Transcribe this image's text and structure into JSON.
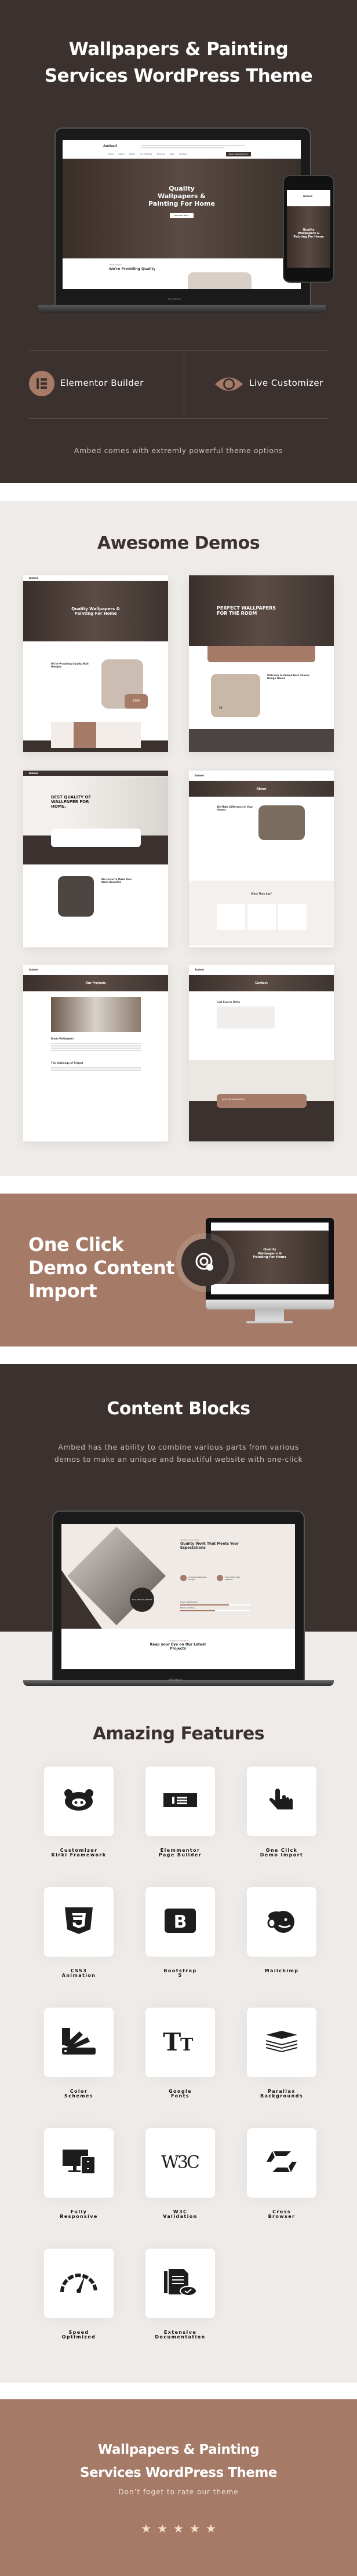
{
  "hero": {
    "title_line1": "Wallpapers & Painting",
    "title_line2": "Services WordPress Theme",
    "mockup": {
      "logo": "Ambed",
      "nav": [
        "Home",
        "About",
        "Pages",
        "Our Projects",
        "Services",
        "Blog",
        "Contact"
      ],
      "cta": "Book Appointment",
      "headline": [
        "Quality",
        "Wallpapers &",
        "Painting For Home"
      ],
      "hero_button": "Discover More",
      "about_tag": "ABOUT COMPANY",
      "about_title": "We're Providing Quality",
      "laptop_brand": "MacBook"
    },
    "features": [
      {
        "icon": "elementor-icon",
        "label": "Elementor Builder"
      },
      {
        "icon": "eye-icon",
        "label": "Live Customizer"
      }
    ],
    "subtitle": "Ambed comes with extremly powerful theme options"
  },
  "demos": {
    "title": "Awesome Demos",
    "items": [
      {
        "headline": "Quality Wallpapers & Painting For Home",
        "content": "We're Providing Quality Wall Designs",
        "stat": "5490"
      },
      {
        "headline": "PERFECT WALLPAPERS FOR THE ROOM",
        "content": "Welcome to Ambed Best Interior Design House",
        "stat": "30"
      },
      {
        "headline": "BEST QUALITY OF WALLPAPER FOR HOME.",
        "content": "We Focus to Make Your Walls Beautiful"
      },
      {
        "headline": "About",
        "content": "We Make Difference In Your Homes",
        "extra": "What They Say?"
      },
      {
        "headline": "Our Projects",
        "content": "Room Wallpapers",
        "extra": "The Challenge of Project"
      },
      {
        "headline": "Contact",
        "content": "Feel Free to Write",
        "extra": "Join Our Newsletter"
      }
    ]
  },
  "one_click": {
    "title_lines": [
      "One Click",
      "Demo Content",
      "Import"
    ],
    "icon": "touch-click-icon",
    "screen_headline": [
      "Quality",
      "Wallpapers &",
      "Painting For Home"
    ]
  },
  "content_blocks": {
    "title": "Content Blocks",
    "description": "Ambed has the ability to combine various parts from various demos to make an unique and beautiful website with one-click",
    "mockup": {
      "tag": "INTERIOR DESIGNING",
      "title": "Quality Work That Meets Your Expectations",
      "point1": "Innovative Wallpaper Designs",
      "point2": "High Quality Wall Materials",
      "bar1": "Interior Wall Design",
      "bar1_value": 70,
      "bar2": "Exterior Painting",
      "bar2_value": 50,
      "badge": "2022 NEW COLLECTION",
      "section_tag": "SUCCESSFUL PROJECT",
      "section_title": "Keep your Eye on Our Latest Projects",
      "laptop_brand": "MacBook"
    }
  },
  "features": {
    "title": "Amazing Features",
    "items": [
      {
        "icon": "kirki-icon",
        "label1": "Customizer",
        "label2": "Kirki Framework"
      },
      {
        "icon": "elementor-icon",
        "label1": "Elemmentor",
        "label2": "Page Builder"
      },
      {
        "icon": "hand-pointer-icon",
        "label1": "One Click",
        "label2": "Demo Import"
      },
      {
        "icon": "css3-icon",
        "label1": "CSS3",
        "label2": "Animation"
      },
      {
        "icon": "bootstrap-icon",
        "label1": "Bootstrap",
        "label2": "5"
      },
      {
        "icon": "mailchimp-icon",
        "label1": "Mailchimp",
        "label2": ""
      },
      {
        "icon": "color-swatch-icon",
        "label1": "Color",
        "label2": "Schemes"
      },
      {
        "icon": "font-icon",
        "label1": "Google",
        "label2": "Fonts"
      },
      {
        "icon": "layers-icon",
        "label1": "Parallax",
        "label2": "Backgrounds"
      },
      {
        "icon": "responsive-devices-icon",
        "label1": "Fully",
        "label2": "Responsive"
      },
      {
        "icon": "w3c-icon",
        "label1": "W3C",
        "label2": "Validation"
      },
      {
        "icon": "cross-browser-icon",
        "label1": "Cross",
        "label2": "Browser"
      },
      {
        "icon": "speedometer-icon",
        "label1": "Speed",
        "label2": "Optimized"
      },
      {
        "icon": "documentation-icon",
        "label1": "Extensive",
        "label2": "Documentation"
      }
    ]
  },
  "footer": {
    "title_line1": "Wallpapers & Painting",
    "title_line2": "Services WordPress Theme",
    "subtitle": "Don’t foget to rate our theme",
    "rating": 5
  },
  "colors": {
    "dark": "#3b3230",
    "brown": "#a57a67",
    "light": "#efebe8",
    "star": "#f3ddd0"
  }
}
